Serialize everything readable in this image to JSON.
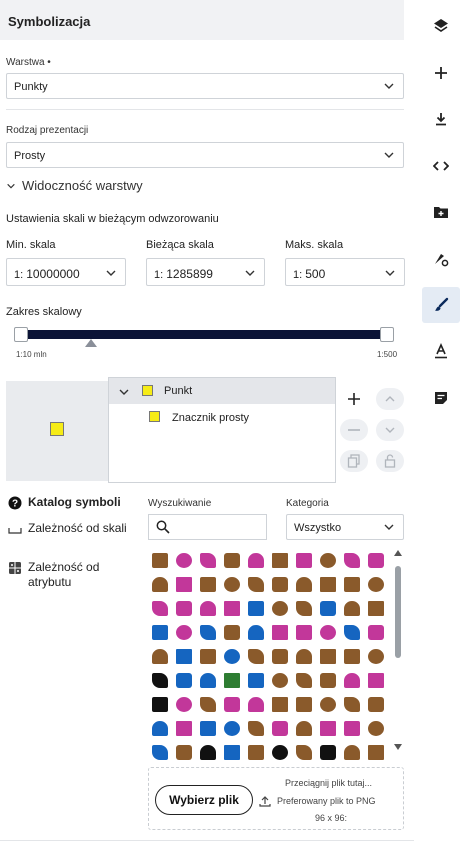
{
  "panel": {
    "title": "Symbolizacja"
  },
  "layer": {
    "label": "Warstwa •",
    "value": "Punkty"
  },
  "presentation": {
    "label": "Rodzaj prezentacji",
    "value": "Prosty"
  },
  "visibility": {
    "section_title": "Widoczność warstwy",
    "scale_settings_label": "Ustawienia skali w bieżącym odwzorowaniu",
    "min": {
      "label": "Min. skala",
      "prefix": "1:",
      "value": "10000000"
    },
    "current": {
      "label": "Bieżąca skala",
      "prefix": "1:",
      "value": "1285899"
    },
    "max": {
      "label": "Maks. skala",
      "prefix": "1:",
      "value": "500"
    },
    "range_label": "Zakres skalowy",
    "range_min_label": "1:10 mln",
    "range_max_label": "1:500",
    "current_marker_fraction": 0.19
  },
  "symbol_tree": {
    "group": {
      "label": "Punkt",
      "color": "#f6ec16"
    },
    "child": {
      "label": "Znacznik prosty",
      "color": "#f6ec16"
    }
  },
  "tabs": [
    {
      "label": "Katalog symboli",
      "icon": "question-circle-icon",
      "active": true
    },
    {
      "label": "Zależność od skali",
      "icon": "scale-ruler-icon",
      "active": false
    },
    {
      "label": "Zależność od atrybutu",
      "icon": "attribute-table-icon",
      "active": false
    }
  ],
  "catalog": {
    "search_label": "Wyszukiwanie",
    "search_value": "",
    "category_label": "Kategoria",
    "category_value": "Wszystko",
    "symbol_colors": [
      "#8a5a2b",
      "#c2379a",
      "#c2379a",
      "#8a5a2b",
      "#c2379a",
      "#8a5a2b",
      "#c2379a",
      "#8a5a2b",
      "#c2379a",
      "#c2379a",
      "#8a5a2b",
      "#c2379a",
      "#8a5a2b",
      "#8a5a2b",
      "#8a5a2b",
      "#8a5a2b",
      "#8a5a2b",
      "#8a5a2b",
      "#8a5a2b",
      "#8a5a2b",
      "#c2379a",
      "#c2379a",
      "#c2379a",
      "#c2379a",
      "#1565c0",
      "#8a5a2b",
      "#8a5a2b",
      "#1565c0",
      "#8a5a2b",
      "#8a5a2b",
      "#1565c0",
      "#c2379a",
      "#1565c0",
      "#8a5a2b",
      "#1565c0",
      "#c2379a",
      "#c2379a",
      "#c2379a",
      "#1565c0",
      "#c2379a",
      "#8a5a2b",
      "#1565c0",
      "#8a5a2b",
      "#1565c0",
      "#8a5a2b",
      "#8a5a2b",
      "#8a5a2b",
      "#8a5a2b",
      "#8a5a2b",
      "#8a5a2b",
      "#111111",
      "#1565c0",
      "#1565c0",
      "#2e7d32",
      "#1565c0",
      "#8a5a2b",
      "#8a5a2b",
      "#8a5a2b",
      "#c2379a",
      "#c2379a",
      "#111111",
      "#c2379a",
      "#8a5a2b",
      "#c2379a",
      "#c2379a",
      "#8a5a2b",
      "#8a5a2b",
      "#8a5a2b",
      "#8a5a2b",
      "#8a5a2b",
      "#1565c0",
      "#c2379a",
      "#1565c0",
      "#1565c0",
      "#8a5a2b",
      "#c2379a",
      "#8a5a2b",
      "#c2379a",
      "#c2379a",
      "#8a5a2b",
      "#1565c0",
      "#8a5a2b",
      "#111111",
      "#1565c0",
      "#8a5a2b",
      "#111111",
      "#8a5a2b",
      "#111111",
      "#8a5a2b",
      "#8a5a2b"
    ]
  },
  "upload": {
    "button_label": "Wybierz plik",
    "hint_line1": "Przeciągnij plik tutaj...",
    "hint_line2": "Preferowany plik to PNG",
    "hint_line3": "96 x 96:"
  },
  "rail": [
    {
      "icon": "layers-icon",
      "active": false
    },
    {
      "icon": "plus-icon",
      "active": false
    },
    {
      "icon": "download-icon",
      "active": false
    },
    {
      "icon": "code-icon",
      "active": false
    },
    {
      "icon": "add-folder-icon",
      "active": false
    },
    {
      "icon": "style-settings-icon",
      "active": false
    },
    {
      "icon": "brush-icon",
      "active": true
    },
    {
      "icon": "text-label-icon",
      "active": false
    },
    {
      "icon": "popup-note-icon",
      "active": false
    }
  ]
}
